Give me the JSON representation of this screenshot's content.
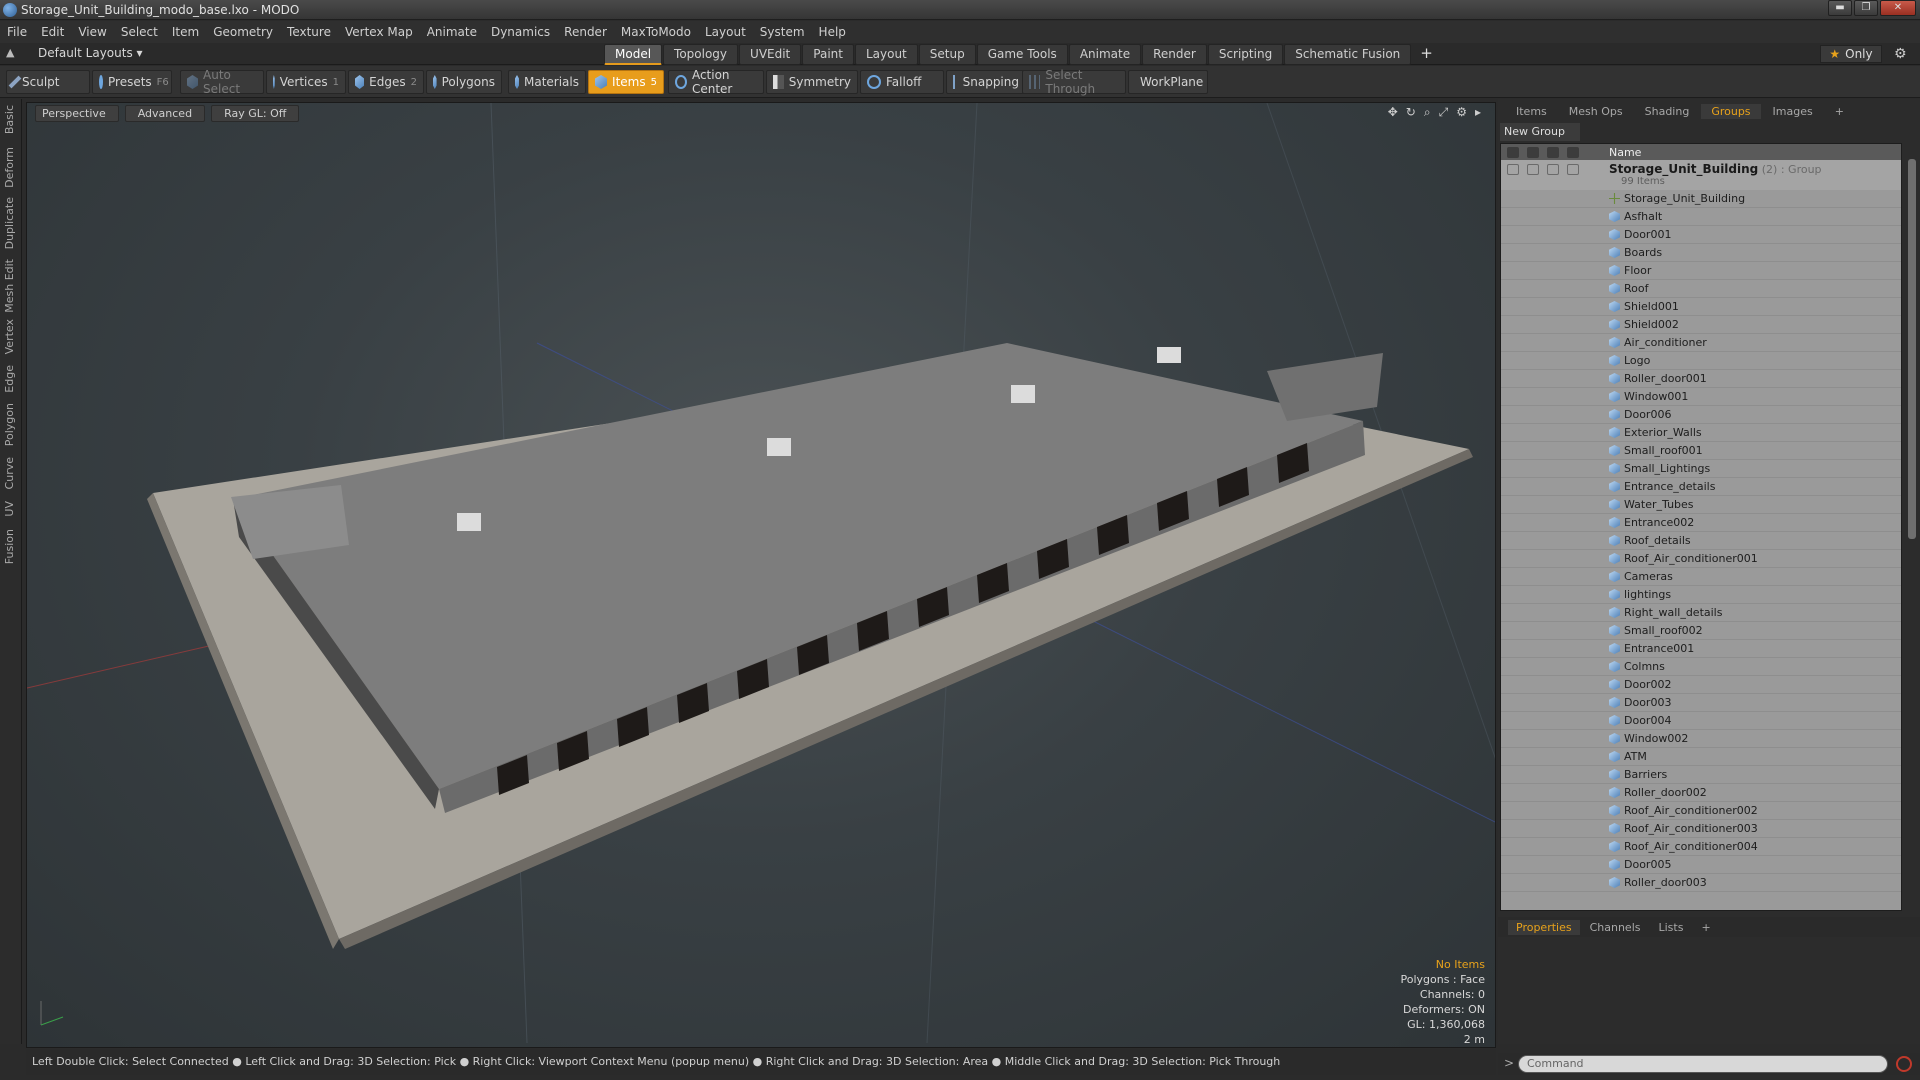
{
  "window": {
    "title": "Storage_Unit_Building_modo_base.lxo - MODO",
    "minimize": "▬",
    "maximize": "❐",
    "close": "✕"
  },
  "menu": [
    "File",
    "Edit",
    "View",
    "Select",
    "Item",
    "Geometry",
    "Texture",
    "Vertex Map",
    "Animate",
    "Dynamics",
    "Render",
    "MaxToModo",
    "Layout",
    "System",
    "Help"
  ],
  "layouts": {
    "label": "Default Layouts ▾"
  },
  "tabs": [
    "Model",
    "Topology",
    "UVEdit",
    "Paint",
    "Layout",
    "Setup",
    "Game Tools",
    "Animate",
    "Render",
    "Scripting",
    "Schematic Fusion"
  ],
  "tab_add": "+",
  "only": "Only",
  "toolbar": {
    "sculpt": "Sculpt",
    "presets": "Presets",
    "presets_key": "F6",
    "auto_select": "Auto Select",
    "vertices": "Vertices",
    "vertices_count": "1",
    "edges": "Edges",
    "edges_count": "2",
    "polygons": "Polygons",
    "materials": "Materials",
    "items": "Items",
    "items_count": "5",
    "action_center": "Action Center",
    "symmetry": "Symmetry",
    "falloff": "Falloff",
    "snapping": "Snapping",
    "select_through": "Select Through",
    "workplane": "WorkPlane"
  },
  "sidetabs": [
    "Basic",
    "Deform",
    "Duplicate",
    "Mesh Edit",
    "Vertex",
    "Edge",
    "Polygon",
    "Curve",
    "UV",
    "Fusion"
  ],
  "viewport": {
    "perspective": "Perspective",
    "advanced": "Advanced",
    "raygl": "Ray GL: Off",
    "info": {
      "no_items": "No Items",
      "polygons": "Polygons : Face",
      "channels": "Channels: 0",
      "deformers": "Deformers: ON",
      "gl": "GL: 1,360,068",
      "scale": "2 m"
    }
  },
  "status": "Left Double Click: Select Connected ● Left Click and Drag: 3D Selection: Pick ● Right Click: Viewport Context Menu (popup menu) ● Right Click and Drag: 3D Selection: Area ● Middle Click and Drag: 3D Selection: Pick Through",
  "right_panel": {
    "tabs": [
      "Items",
      "Mesh Ops",
      "Shading",
      "Groups",
      "Images"
    ],
    "tab_add": "+",
    "new_group": "New Group",
    "name_header": "Name",
    "group": {
      "name": "Storage_Unit_Building",
      "count": "(2) : Group",
      "items": "99 Items"
    },
    "items": [
      "Storage_Unit_Building",
      "Asfhalt",
      "Door001",
      "Boards",
      "Floor",
      "Roof",
      "Shield001",
      "Shield002",
      "Air_conditioner",
      "Logo",
      "Roller_door001",
      "Window001",
      "Door006",
      "Exterior_Walls",
      "Small_roof001",
      "Small_Lightings",
      "Entrance_details",
      "Water_Tubes",
      "Entrance002",
      "Roof_details",
      "Roof_Air_conditioner001",
      "Cameras",
      "lightings",
      "Right_wall_details",
      "Small_roof002",
      "Entrance001",
      "Colmns",
      "Door002",
      "Door003",
      "Door004",
      "Window002",
      "ATM",
      "Barriers",
      "Roller_door002",
      "Roof_Air_conditioner002",
      "Roof_Air_conditioner003",
      "Roof_Air_conditioner004",
      "Door005",
      "Roller_door003"
    ]
  },
  "properties_tabs": [
    "Properties",
    "Channels",
    "Lists"
  ],
  "properties_add": "+",
  "command": {
    "placeholder": "Command",
    "prompt": ">"
  }
}
